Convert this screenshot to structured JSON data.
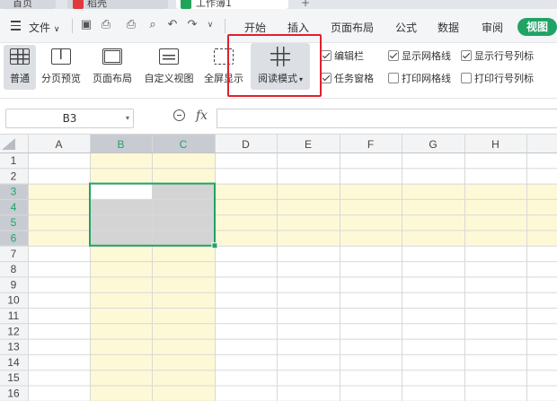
{
  "tabs": [
    {
      "label": "首页"
    },
    {
      "label": "稻壳"
    },
    {
      "label": "工作簿1"
    }
  ],
  "menu": {
    "file_label": "文件",
    "items": [
      "开始",
      "插入",
      "页面布局",
      "公式",
      "数据",
      "审阅"
    ],
    "active": "视图"
  },
  "ribbon": {
    "buttons": [
      "普通",
      "分页预览",
      "页面布局",
      "自定义视图",
      "全屏显示"
    ],
    "read_mode": "阅读模式",
    "checks": [
      {
        "label": "编辑栏",
        "checked": true
      },
      {
        "label": "任务窗格",
        "checked": true
      },
      {
        "label": "显示网格线",
        "checked": true
      },
      {
        "label": "打印网格线",
        "checked": false
      },
      {
        "label": "显示行号列标",
        "checked": true
      },
      {
        "label": "打印行号列标",
        "checked": false
      }
    ]
  },
  "formula_bar": {
    "name_box": "B3",
    "fx_label": "fx",
    "content": ""
  },
  "sheet": {
    "columns": [
      "A",
      "B",
      "C",
      "D",
      "E",
      "F",
      "G",
      "H"
    ],
    "rows": [
      "1",
      "2",
      "3",
      "4",
      "5",
      "6",
      "7",
      "8",
      "9",
      "10",
      "11",
      "12",
      "13",
      "14",
      "15",
      "16"
    ],
    "active_cell": "B3",
    "selected_range": "B3:C6",
    "colors": {
      "highlight": "#fdf9d6",
      "selection_fill": "#d4d4d4",
      "selection_border": "#21a366",
      "header_selected": "#c8ccd2",
      "header_text_selected": "#21a366",
      "read_mode_outline": "#e0202b"
    }
  }
}
